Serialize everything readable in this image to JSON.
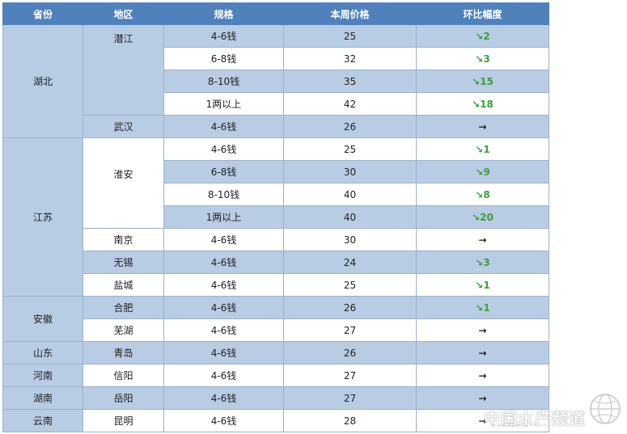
{
  "headers": {
    "province": "省份",
    "region": "地区",
    "spec": "规格",
    "price": "本周价格",
    "change": "环比幅度"
  },
  "rows": [
    {
      "province": "湖北",
      "region": "潜江",
      "spec": "4-6钱",
      "price": "25",
      "change": "↘2",
      "trend": "down"
    },
    {
      "spec": "6-8钱",
      "price": "32",
      "change": "↘3",
      "trend": "down"
    },
    {
      "spec": "8-10钱",
      "price": "35",
      "change": "↘15",
      "trend": "down"
    },
    {
      "spec": "1两以上",
      "price": "42",
      "change": "↘18",
      "trend": "down"
    },
    {
      "region": "武汉",
      "spec": "4-6钱",
      "price": "26",
      "change": "→",
      "trend": "flat"
    },
    {
      "province": "江苏",
      "region": "淮安",
      "spec": "4-6钱",
      "price": "25",
      "change": "↘1",
      "trend": "down"
    },
    {
      "spec": "6-8钱",
      "price": "30",
      "change": "↘9",
      "trend": "down"
    },
    {
      "spec": "8-10钱",
      "price": "40",
      "change": "↘8",
      "trend": "down"
    },
    {
      "spec": "1两以上",
      "price": "40",
      "change": "↘20",
      "trend": "down"
    },
    {
      "region": "南京",
      "spec": "4-6钱",
      "price": "30",
      "change": "→",
      "trend": "flat"
    },
    {
      "region": "无锡",
      "spec": "4-6钱",
      "price": "24",
      "change": "↘3",
      "trend": "down"
    },
    {
      "region": "盐城",
      "spec": "4-6钱",
      "price": "25",
      "change": "↘1",
      "trend": "down"
    },
    {
      "province": "安徽",
      "region": "合肥",
      "spec": "4-6钱",
      "price": "26",
      "change": "↘1",
      "trend": "down"
    },
    {
      "region": "芜湖",
      "spec": "4-6钱",
      "price": "27",
      "change": "→",
      "trend": "flat"
    },
    {
      "province": "山东",
      "region": "青岛",
      "spec": "4-6钱",
      "price": "26",
      "change": "→",
      "trend": "flat"
    },
    {
      "province": "河南",
      "region": "信阳",
      "spec": "4-6钱",
      "price": "27",
      "change": "→",
      "trend": "flat"
    },
    {
      "province": "湖南",
      "region": "岳阳",
      "spec": "4-6钱",
      "price": "27",
      "change": "→",
      "trend": "flat"
    },
    {
      "province": "云南",
      "region": "昆明",
      "spec": "4-6钱",
      "price": "28",
      "change": "→",
      "trend": "flat"
    }
  ],
  "watermark": {
    "name": "中国水产频道",
    "url": "www.bbwfish.com"
  },
  "colors": {
    "header": "#4f81bd",
    "band": "#b8cce4",
    "down": "#3aa03a"
  }
}
